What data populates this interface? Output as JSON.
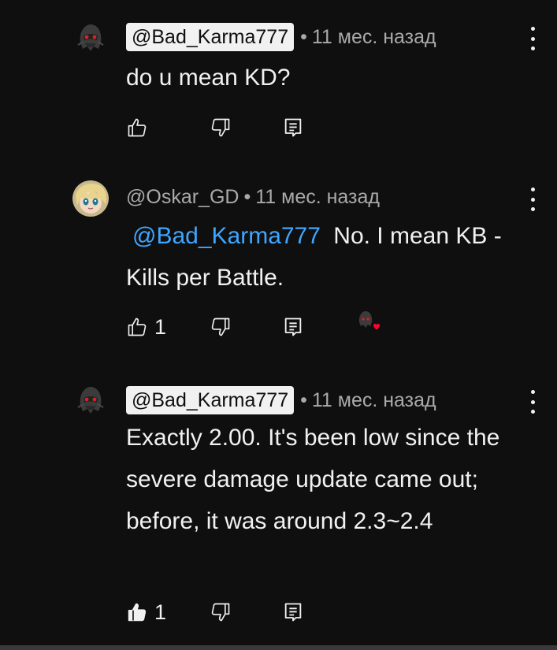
{
  "comments": [
    {
      "author": "@Bad_Karma777",
      "time": "11 мес. назад",
      "text": "do u mean KD?",
      "likes": ""
    },
    {
      "author": "@Oskar_GD",
      "time": "11 мес. назад",
      "mention": "@Bad_Karma777",
      "text": "No. I mean KB - Kills per Battle.",
      "likes": "1"
    },
    {
      "author": "@Bad_Karma777",
      "time": "11 мес. назад",
      "text": "Exactly 2.00. It's been low since the severe damage update came out; before, it was around 2.3~2.4",
      "likes": "1"
    }
  ],
  "separator": "•",
  "colors": {
    "background": "#0f0f0f",
    "text": "#f1f1f1",
    "meta": "#aaaaaa",
    "mention": "#3ea6ff",
    "heart": "#ff0033"
  },
  "icons": [
    "like-icon",
    "dislike-icon",
    "reply-icon",
    "more-vert-icon",
    "heart-icon"
  ]
}
